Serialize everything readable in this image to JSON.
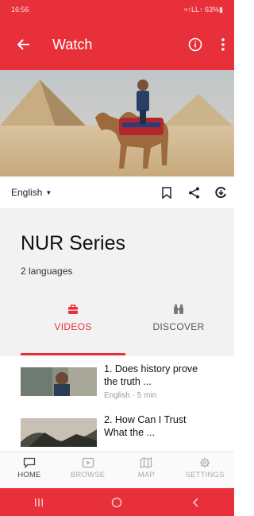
{
  "status_bar": {
    "time": "16:56",
    "indicators": "≈↑LL↑ 63%▮"
  },
  "app_bar": {
    "title": "Watch",
    "back_icon": "arrow-left-icon",
    "info_icon": "info-icon",
    "more_icon": "more-vertical-icon"
  },
  "toolbar": {
    "language": "English",
    "icons": [
      "bookmark-icon",
      "share-icon",
      "download-icon"
    ]
  },
  "series": {
    "title": "NUR Series",
    "subtitle": "2 languages"
  },
  "tabs": [
    {
      "label": "VIDEOS",
      "icon": "briefcase-icon",
      "active": true
    },
    {
      "label": "DISCOVER",
      "icon": "binoculars-icon",
      "active": false
    }
  ],
  "videos": [
    {
      "title": "1. Does history prove the truth ...",
      "meta": "English · 5 min"
    },
    {
      "title": "2. How Can I Trust What the ...",
      "meta": ""
    }
  ],
  "bottom_nav": [
    {
      "label": "HOME",
      "icon": "chat-icon",
      "active": true
    },
    {
      "label": "BROWSE",
      "icon": "play-square-icon",
      "active": false
    },
    {
      "label": "MAP",
      "icon": "map-icon",
      "active": false
    },
    {
      "label": "SETTINGS",
      "icon": "gear-icon",
      "active": false
    }
  ],
  "colors": {
    "primary": "#e8303a",
    "panel": "#f3f2f2"
  }
}
